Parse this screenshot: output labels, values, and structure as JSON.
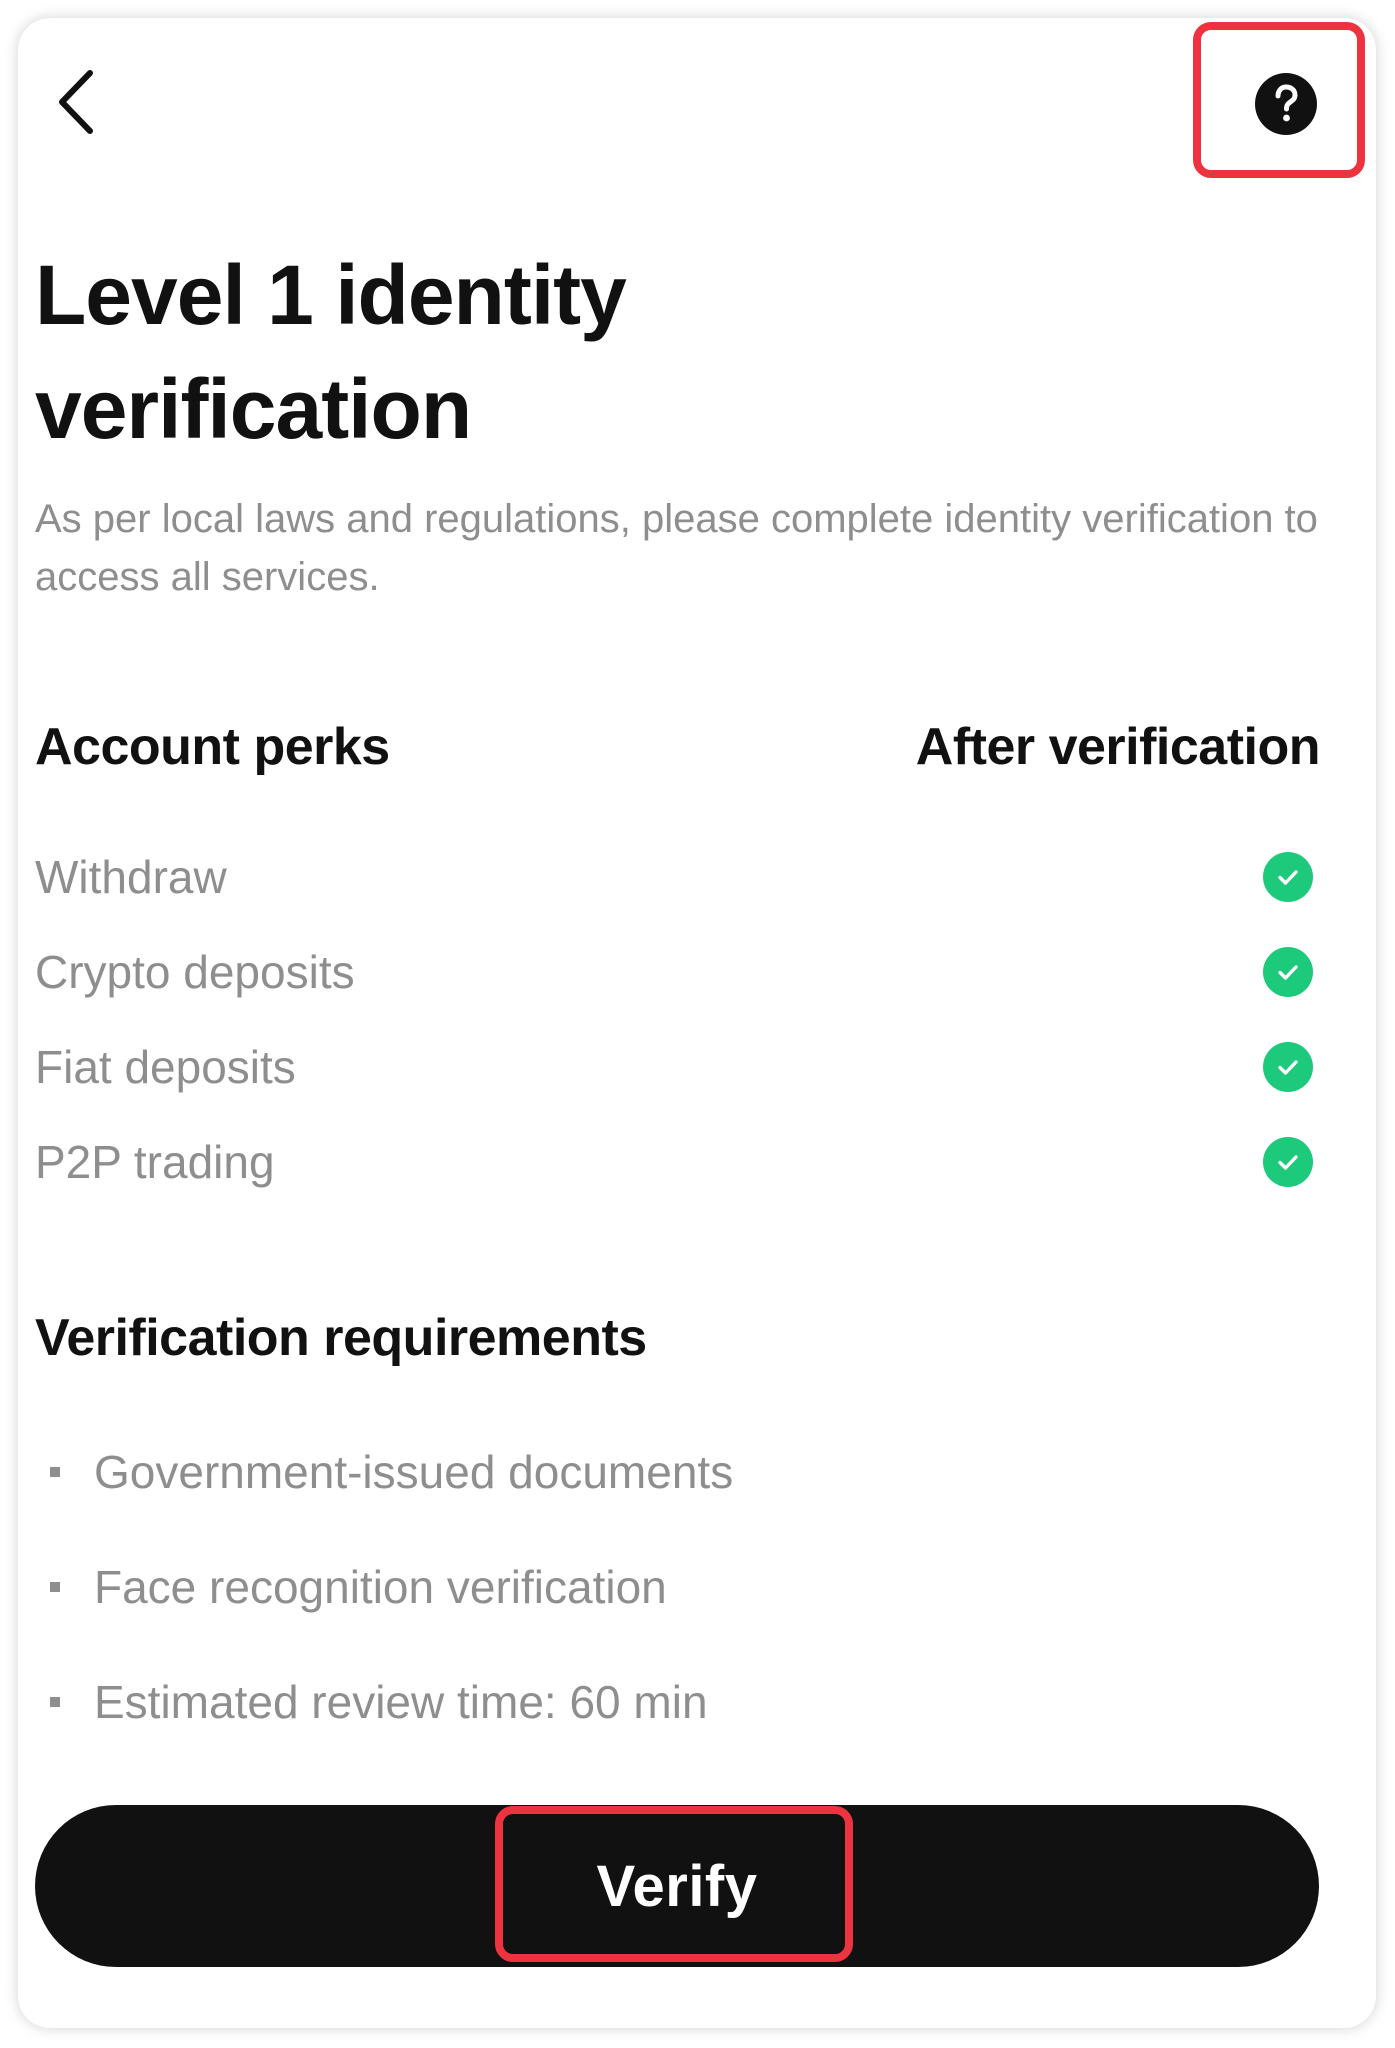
{
  "header": {
    "back_icon": "chevron-left-icon",
    "help_icon": "question-circle-icon"
  },
  "title": "Level 1 identity verification",
  "subtitle": "As per local laws and regulations, please complete identity verification to access all services.",
  "perks": {
    "column_left": "Account perks",
    "column_right": "After verification",
    "items": [
      {
        "label": "Withdraw",
        "status_icon": "check-circle-icon"
      },
      {
        "label": "Crypto deposits",
        "status_icon": "check-circle-icon"
      },
      {
        "label": "Fiat deposits",
        "status_icon": "check-circle-icon"
      },
      {
        "label": "P2P trading",
        "status_icon": "check-circle-icon"
      }
    ]
  },
  "requirements": {
    "title": "Verification requirements",
    "items": [
      "Government-issued documents",
      "Face recognition verification",
      "Estimated review time: 60 min"
    ]
  },
  "verify_button": {
    "label": "Verify"
  },
  "colors": {
    "primary": "#111111",
    "muted_text": "#8e8e8e",
    "success": "#1dc97a",
    "highlight": "#ee3340"
  }
}
